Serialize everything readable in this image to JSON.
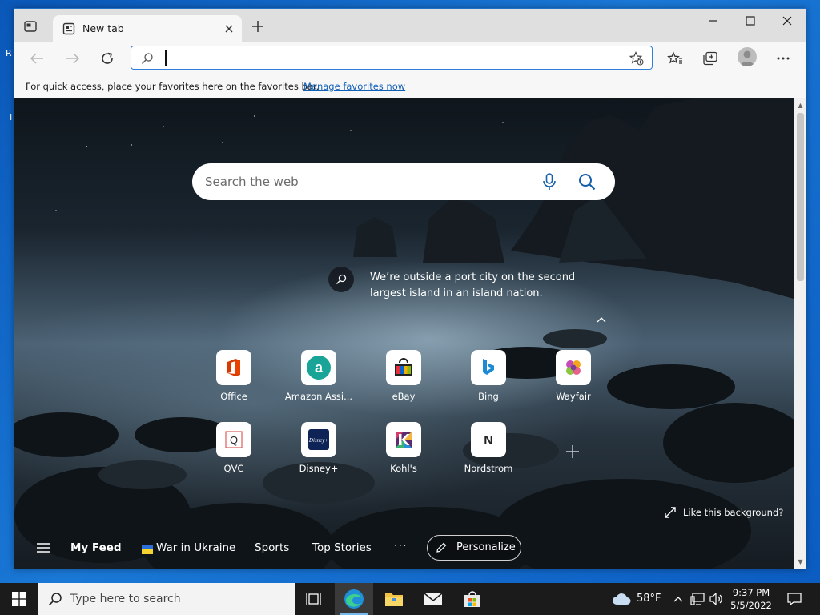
{
  "desktop": {
    "fragment_r": "R",
    "fragment_l": "I"
  },
  "browser": {
    "tab": {
      "title": "New tab"
    },
    "address": {
      "value": ""
    },
    "favorites_bar": {
      "message": "For quick access, place your favorites here on the favorites bar.",
      "link": "Manage favorites now"
    }
  },
  "newtab": {
    "search": {
      "placeholder": "Search the web"
    },
    "caption": "We’re outside a port city on the second largest island in an island nation.",
    "tiles": [
      {
        "label": "Office"
      },
      {
        "label": "Amazon Assi..."
      },
      {
        "label": "eBay"
      },
      {
        "label": "Bing"
      },
      {
        "label": "Wayfair"
      },
      {
        "label": "QVC"
      },
      {
        "label": "Disney+"
      },
      {
        "label": "Kohl's"
      },
      {
        "label": "Nordstrom"
      }
    ],
    "tile_letters": {
      "amazon": "a",
      "qvc": "Q",
      "nordstrom": "N",
      "disney": "Disney+"
    },
    "like_background": "Like this background?",
    "feed": {
      "my_feed": "My Feed",
      "war": "War in Ukraine",
      "sports": "Sports",
      "top_stories": "Top Stories",
      "more": "···",
      "personalize": "Personalize"
    }
  },
  "taskbar": {
    "search_placeholder": "Type here to search",
    "weather": "58°F",
    "time": "9:37 PM",
    "date": "5/5/2022"
  },
  "colors": {
    "accent": "#2f7ed8",
    "taskbar": "#1b1b1b",
    "link": "#1260b8"
  }
}
